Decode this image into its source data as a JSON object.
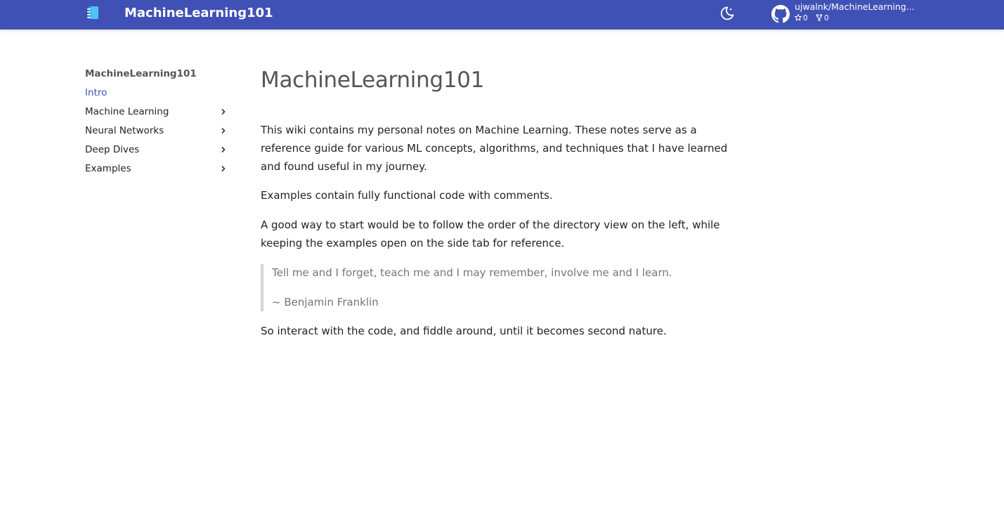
{
  "header": {
    "site_title": "MachineLearning101",
    "icons": {
      "logo": "notebook-icon",
      "theme": "moon-icon",
      "repo": "github-icon"
    },
    "repo": {
      "name": "ujwalnk/MachineLearning...",
      "stars": "0",
      "forks": "0"
    },
    "colors": {
      "primary": "#3f51b5",
      "accent_text": "#ffffff",
      "logo": "#4fc3f7"
    }
  },
  "sidebar": {
    "title": "MachineLearning101",
    "items": [
      {
        "label": "Intro",
        "active": true,
        "expandable": false
      },
      {
        "label": "Machine Learning",
        "active": false,
        "expandable": true
      },
      {
        "label": "Neural Networks",
        "active": false,
        "expandable": true
      },
      {
        "label": "Deep Dives",
        "active": false,
        "expandable": true
      },
      {
        "label": "Examples",
        "active": false,
        "expandable": true
      }
    ]
  },
  "main": {
    "title": "MachineLearning101",
    "paragraphs": [
      "This wiki contains my personal notes on Machine Learning. These notes serve as a reference guide for various ML concepts, algorithms, and techniques that I have learned and found useful in my journey.",
      "Examples contain fully functional code with comments.",
      "A good way to start would be to follow the order of the directory view on the left, while keeping the examples open on the side tab for reference."
    ],
    "quote": {
      "text": "Tell me and I forget, teach me and I may remember, involve me and I learn.",
      "author": "~ Benjamin Franklin"
    },
    "closing": "So interact with the code, and fiddle around, until it becomes second nature."
  }
}
